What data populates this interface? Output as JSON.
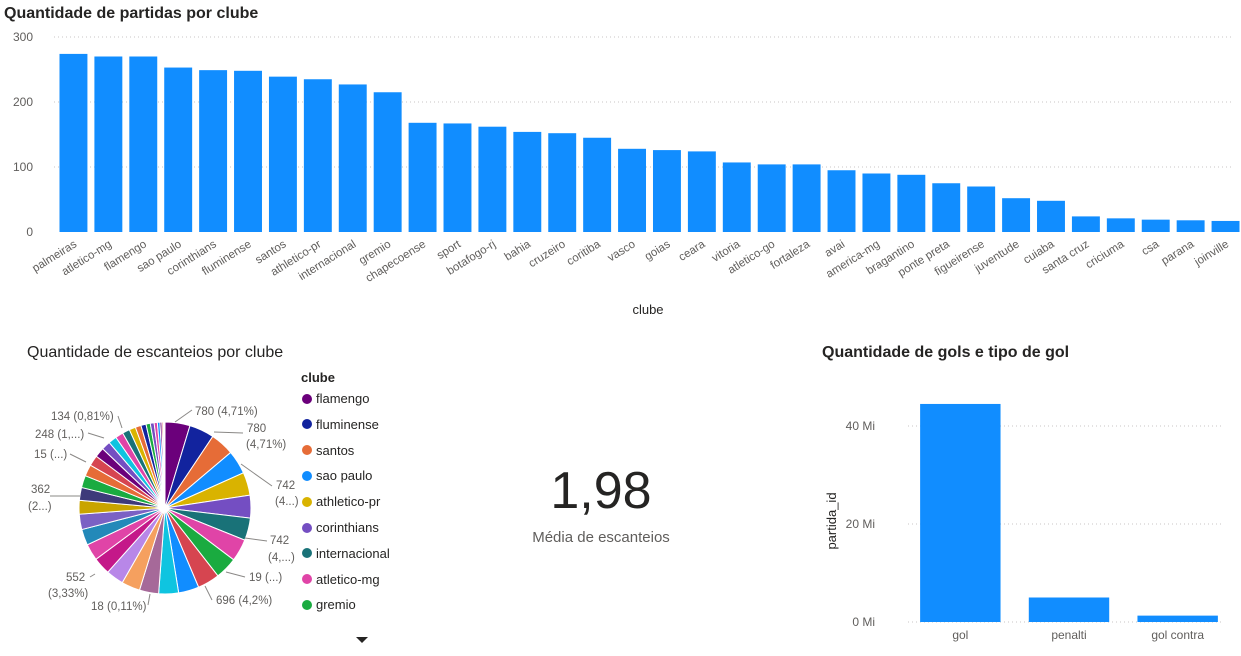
{
  "top_chart": {
    "title": "Quantidade de partidas por clube",
    "xlabel": "clube",
    "y_ticks": [
      "300",
      "200",
      "100",
      "0"
    ],
    "chart_data": {
      "type": "bar",
      "title": "Quantidade de partidas por clube",
      "xlabel": "clube",
      "ylabel": "",
      "ylim": [
        0,
        300
      ],
      "grid": true,
      "bar_color": "#118DFF",
      "categories": [
        "palmeiras",
        "atletico-mg",
        "flamengo",
        "sao paulo",
        "corinthians",
        "fluminense",
        "santos",
        "athletico-pr",
        "internacional",
        "gremio",
        "chapecoense",
        "sport",
        "botafogo-rj",
        "bahia",
        "cruzeiro",
        "coritiba",
        "vasco",
        "goias",
        "ceara",
        "vitoria",
        "atletico-go",
        "fortaleza",
        "avai",
        "america-mg",
        "bragantino",
        "ponte preta",
        "figueirense",
        "juventude",
        "cuiaba",
        "santa cruz",
        "criciuma",
        "csa",
        "parana",
        "joinville"
      ],
      "values": [
        274,
        270,
        270,
        253,
        249,
        248,
        239,
        235,
        227,
        215,
        168,
        167,
        162,
        154,
        152,
        145,
        128,
        126,
        124,
        107,
        104,
        104,
        95,
        90,
        88,
        75,
        70,
        52,
        48,
        24,
        21,
        19,
        18,
        17
      ]
    }
  },
  "pie_chart": {
    "title": "Quantidade de escanteios por clube",
    "legend_title": "clube",
    "legend": [
      {
        "label": "flamengo",
        "color": "#6B007B"
      },
      {
        "label": "fluminense",
        "color": "#12239E"
      },
      {
        "label": "santos",
        "color": "#E66C37"
      },
      {
        "label": "sao paulo",
        "color": "#118DFF"
      },
      {
        "label": "athletico-pr",
        "color": "#D9B300"
      },
      {
        "label": "corinthians",
        "color": "#744EC2"
      },
      {
        "label": "internacional",
        "color": "#197278"
      },
      {
        "label": "atletico-mg",
        "color": "#E044A7"
      },
      {
        "label": "gremio",
        "color": "#1AAB40"
      }
    ],
    "labels": {
      "l1": "780 (4,71%)",
      "l2a": "780",
      "l2b": "(4,71%)",
      "l3a": "742",
      "l3b": "(4...)",
      "l4a": "742",
      "l4b": "(4,...)",
      "l5": "19 (...)",
      "l6": "696 (4,2%)",
      "l7": "18 (0,11%)",
      "l8a": "552",
      "l8b": "(3,33%)",
      "l9a": "362",
      "l9b": "(2...)",
      "l10": "15 (...)",
      "l11": "248 (1,...)",
      "l12": "134 (0,81%)"
    },
    "chart_data": {
      "type": "pie",
      "title": "Quantidade de escanteios por clube",
      "slices": [
        {
          "label": "flamengo",
          "value": 780,
          "percent": 4.71,
          "color": "#6B007B"
        },
        {
          "label": "fluminense",
          "value": 780,
          "percent": 4.71,
          "color": "#12239E"
        },
        {
          "label": "santos",
          "value": 742,
          "color": "#E66C37"
        },
        {
          "label": "sao paulo",
          "value": 742,
          "color": "#118DFF"
        },
        {
          "label": "athletico-pr",
          "value": 720,
          "color": "#D9B300"
        },
        {
          "label": "corinthians",
          "value": 710,
          "color": "#744EC2"
        },
        {
          "label": "internacional",
          "value": 700,
          "color": "#197278"
        },
        {
          "label": "atletico-mg",
          "value": 698,
          "color": "#E044A7"
        },
        {
          "label": "gremio",
          "value": 696,
          "percent": 4.2,
          "color": "#1AAB40"
        },
        {
          "label": "",
          "value": 690,
          "color": "#D64550"
        },
        {
          "label": "",
          "value": 640,
          "color": "#118DFF"
        },
        {
          "label": "",
          "value": 620,
          "color": "#0FC4E0"
        },
        {
          "label": "",
          "value": 600,
          "color": "#A66999"
        },
        {
          "label": "",
          "value": 580,
          "color": "#F5A05F"
        },
        {
          "label": "",
          "value": 552,
          "percent": 3.33,
          "color": "#B887E8"
        },
        {
          "label": "",
          "value": 540,
          "color": "#C41889"
        },
        {
          "label": "",
          "value": 520,
          "color": "#E044A7"
        },
        {
          "label": "",
          "value": 500,
          "color": "#2389B9"
        },
        {
          "label": "",
          "value": 480,
          "color": "#7B61C4"
        },
        {
          "label": "",
          "value": 430,
          "color": "#C9A400"
        },
        {
          "label": "",
          "value": 400,
          "color": "#3E3A7A"
        },
        {
          "label": "",
          "value": 380,
          "color": "#1AAB40"
        },
        {
          "label": "",
          "value": 362,
          "color": "#E66C37"
        },
        {
          "label": "",
          "value": 330,
          "color": "#D64550"
        },
        {
          "label": "",
          "value": 300,
          "color": "#6B007B"
        },
        {
          "label": "",
          "value": 280,
          "color": "#744EC2"
        },
        {
          "label": "",
          "value": 260,
          "color": "#0FC4E0"
        },
        {
          "label": "",
          "value": 248,
          "color": "#E044A7"
        },
        {
          "label": "",
          "value": 230,
          "color": "#197278"
        },
        {
          "label": "",
          "value": 200,
          "color": "#D9B300"
        },
        {
          "label": "",
          "value": 180,
          "color": "#E66C37"
        },
        {
          "label": "",
          "value": 160,
          "color": "#12239E"
        },
        {
          "label": "",
          "value": 134,
          "percent": 0.81,
          "color": "#1AAB40"
        },
        {
          "label": "",
          "value": 120,
          "color": "#744EC2"
        },
        {
          "label": "",
          "value": 100,
          "color": "#E044A7"
        },
        {
          "label": "",
          "value": 80,
          "color": "#118DFF"
        },
        {
          "label": "",
          "value": 60,
          "color": "#6B007B"
        },
        {
          "label": "",
          "value": 45,
          "color": "#D64550"
        },
        {
          "label": "",
          "value": 19,
          "color": "#C9A400"
        },
        {
          "label": "",
          "value": 18,
          "percent": 0.11,
          "color": "#0FC4E0"
        },
        {
          "label": "",
          "value": 15,
          "color": "#197278"
        }
      ]
    }
  },
  "kpi": {
    "value": "1,98",
    "label": "Média de escanteios"
  },
  "bottom_chart": {
    "title": "Quantidade de gols e tipo de gol",
    "ylabel": "partida_id",
    "y_ticks": [
      "40 Mi",
      "20 Mi",
      "0 Mi"
    ],
    "chart_data": {
      "type": "bar",
      "title": "Quantidade de gols e tipo de gol",
      "xlabel": "",
      "ylabel": "partida_id",
      "ylim": [
        0,
        48
      ],
      "unit": "Mi",
      "grid": true,
      "bar_color": "#118DFF",
      "categories": [
        "gol",
        "penalti",
        "gol contra"
      ],
      "values": [
        44.5,
        5,
        1.3
      ]
    }
  }
}
